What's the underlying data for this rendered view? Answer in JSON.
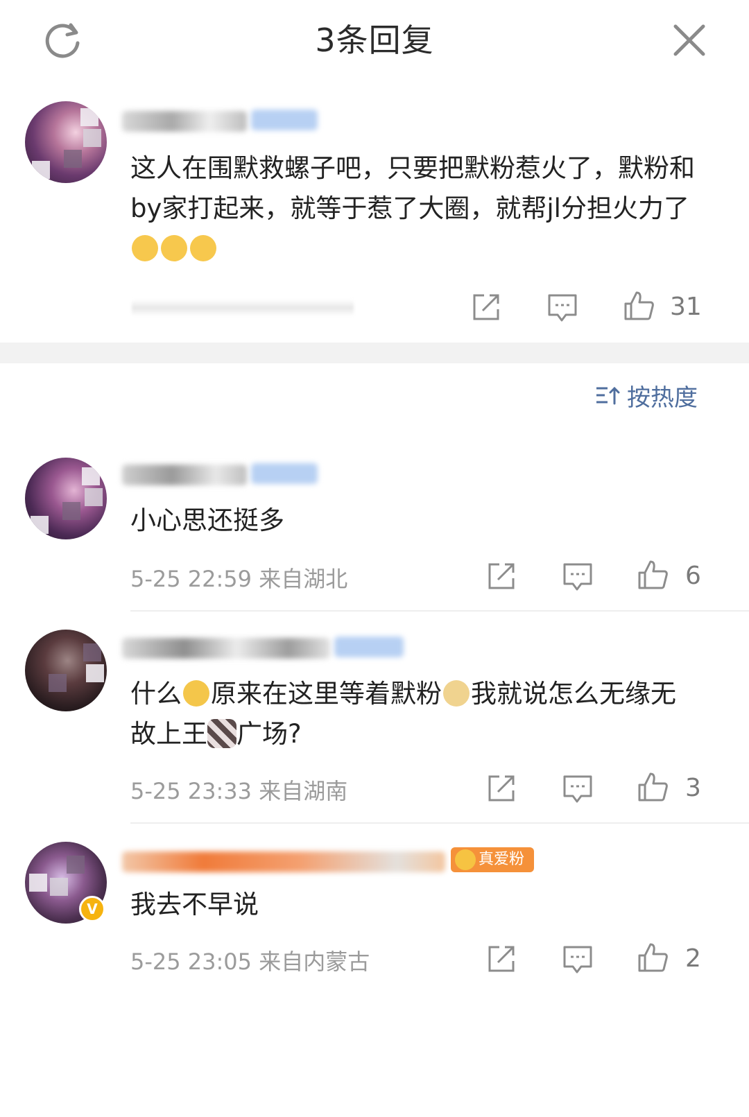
{
  "header": {
    "title": "3条回复",
    "refresh_icon": "refresh-icon",
    "close_icon": "close-icon"
  },
  "root_comment": {
    "text": "这人在围默救螺子吧，只要把默粉惹火了，默粉和by家打起来，就等于惹了大圈，就帮jl分担火力了",
    "emoji": [
      "666-emoji",
      "666-emoji",
      "666-emoji"
    ],
    "likes": "31"
  },
  "sort": {
    "label": "按热度",
    "icon": "sort-icon"
  },
  "replies": [
    {
      "text": "小心思还挺多",
      "time": "5-25 22:59",
      "location": "来自湖北",
      "likes": "6"
    },
    {
      "text_a": "什么",
      "text_b": "原来在这里等着默粉",
      "text_c": "我就说怎么无缘无故上王",
      "text_d": "广场?",
      "time": "5-25 23:33",
      "location": "来自湖南",
      "likes": "3"
    },
    {
      "text": "我去不早说",
      "time": "5-25 23:05",
      "location": "来自内蒙古",
      "likes": "2",
      "fan_badge": "真爱粉",
      "verified": "V"
    }
  ],
  "colors": {
    "link_blue": "#4f6e9e",
    "meta_gray": "#9b9b9b",
    "fan_orange": "#f5913a",
    "verified_gold": "#f6b30f"
  }
}
